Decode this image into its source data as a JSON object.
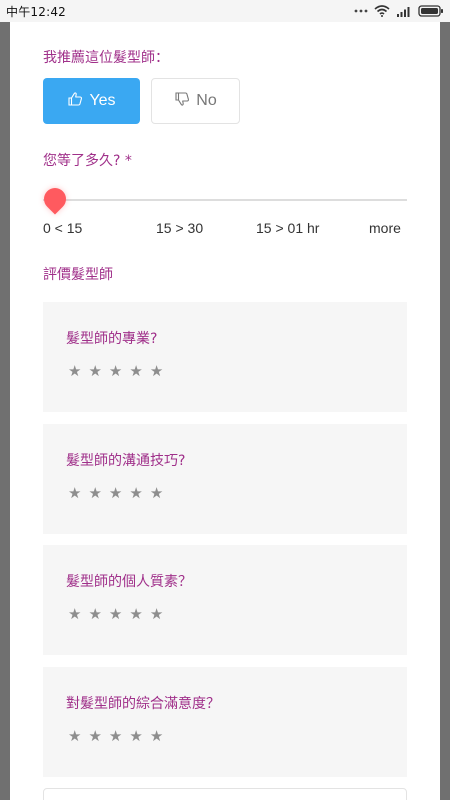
{
  "status_bar": {
    "time": "中午12:42",
    "battery_icon": "battery-icon",
    "wifi_icon": "wifi-icon",
    "signal_icon": "signal-icon",
    "more_icon": "more-dots-icon"
  },
  "recommend": {
    "label": "我推薦這位髮型師：",
    "yes_label": "Yes",
    "no_label": "No"
  },
  "wait": {
    "label": "您等了多久?",
    "required": "*",
    "ticks": [
      "0 < 15",
      "15 > 30",
      "15 > 01 hr",
      "more"
    ],
    "selected_index": 0
  },
  "rating_section": {
    "title": "評價髮型師",
    "questions": [
      {
        "label": "髮型師的專業?",
        "rating": 0
      },
      {
        "label": "髮型師的溝通技巧?",
        "rating": 0
      },
      {
        "label": "髮型師的個人質素？",
        "rating": 0
      },
      {
        "label": "對髮型師的綜合滿意度？",
        "rating": 0
      }
    ],
    "star_glyph": "★",
    "star_count": 5
  },
  "colors": {
    "accent_purple": "#a0308a",
    "yes_blue": "#3aa8f2",
    "slider_red": "#ff5a5f",
    "star_gray": "#8e8e8e"
  }
}
